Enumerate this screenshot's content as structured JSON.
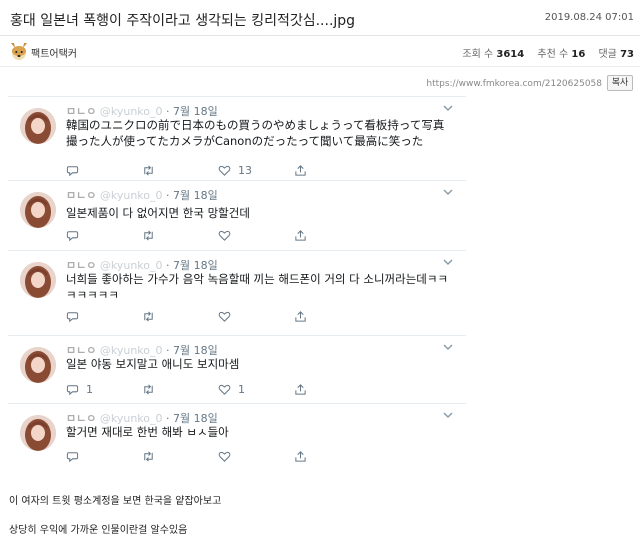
{
  "post": {
    "title": "홍대 일본녀 폭행이 주작이라고 생각되는 킹리적갓심....jpg",
    "date": "2019.08.24 07:01",
    "author": "팩트어택커",
    "views_label": "조회 수",
    "views": "3614",
    "likes_label": "추천 수",
    "likes": "16",
    "comments_label": "댓글",
    "comments": "73",
    "source_url": "https://www.fmkorea.com/2120625058",
    "copy_label": "복사"
  },
  "tweets": [
    {
      "name": "ㅁㄴㅇ",
      "handle": "@kyunko_0",
      "date": "· 7월 18일",
      "text": "韓国のユニクロの前で日本のもの買うのやめましょうって看板持って写真撮った人が使ってたカメラがCanonのだったって聞いて最高に笑った",
      "replies": "",
      "retweets": "",
      "likes": "13"
    },
    {
      "name": "ㅁㄴㅇ",
      "handle": "@kyunko_0",
      "date": "· 7월 18일",
      "text": "일본제품이 다 없어지면 한국 망할건데",
      "replies": "",
      "retweets": "",
      "likes": ""
    },
    {
      "name": "ㅁㄴㅇ",
      "handle": "@kyunko_0",
      "date": "· 7월 18일",
      "text": "너희들 좋아하는 가수가 음악 녹음할때 끼는 해드폰이 거의 다 소니꺼라는데ㅋㅋㅋㅋㅋㅋㅋ",
      "replies": "",
      "retweets": "",
      "likes": ""
    },
    {
      "name": "ㅁㄴㅇ",
      "handle": "@kyunko_0",
      "date": "· 7월 18일",
      "text": "일본 야동 보지말고 애니도 보지마셈",
      "replies": "1",
      "retweets": "",
      "likes": "1"
    },
    {
      "name": "ㅁㄴㅇ",
      "handle": "@kyunko_0",
      "date": "· 7월 18일",
      "text": "할거면 재대로 한번 해봐 ㅂㅅ들아",
      "replies": "",
      "retweets": "",
      "likes": ""
    }
  ],
  "captions": [
    "이 여자의 트윗 평소계정을 보면 한국을 얕잡아보고",
    "상당히 우익에 가까운 인물이란걸 알수있음"
  ],
  "icons": {
    "reply": "reply-icon",
    "retweet": "retweet-icon",
    "like": "heart-icon",
    "share": "share-icon",
    "menu": "chevron-down-icon"
  }
}
